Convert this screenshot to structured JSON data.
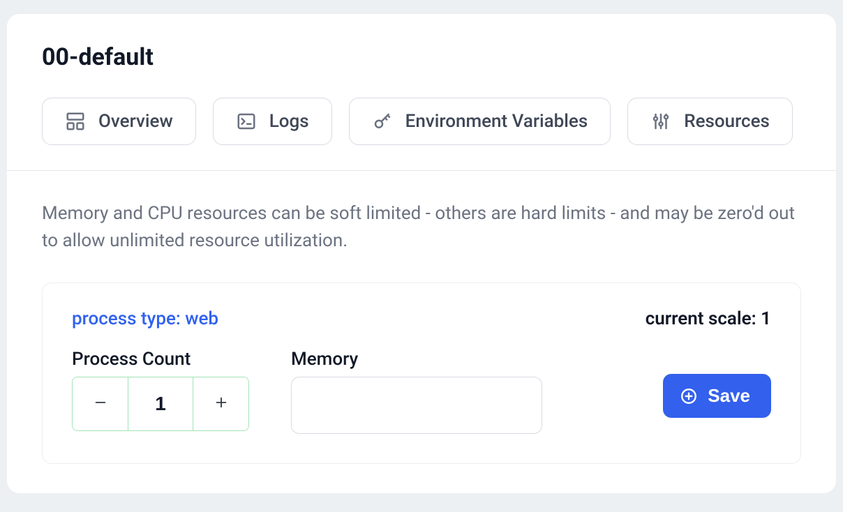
{
  "header": {
    "title": "00-default"
  },
  "tabs": [
    {
      "label": "Overview",
      "icon": "overview"
    },
    {
      "label": "Logs",
      "icon": "terminal"
    },
    {
      "label": "Environment Variables",
      "icon": "key"
    },
    {
      "label": "Resources",
      "icon": "sliders"
    }
  ],
  "body": {
    "description": "Memory and CPU resources can be soft limited - others are hard limits - and may be zero'd out to allow unlimited resource utilization."
  },
  "process": {
    "type_label": "process type: web",
    "scale_label": "current scale: 1",
    "count_label": "Process Count",
    "count_value": "1",
    "memory_label": "Memory",
    "memory_value": "",
    "save_label": "Save"
  },
  "colors": {
    "accent": "#3360ec",
    "link": "#3061f0",
    "stepper_border": "#a3e3b6"
  }
}
